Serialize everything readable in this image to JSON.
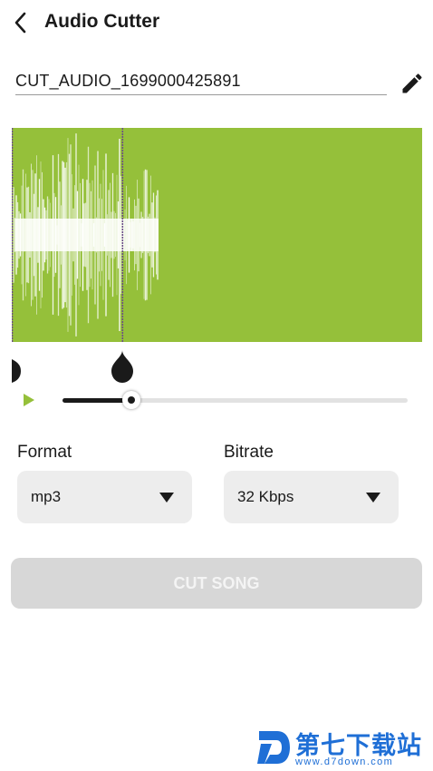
{
  "header": {
    "title": "Audio Cutter",
    "back_icon": "chevron-left-icon"
  },
  "file": {
    "name": "CUT_AUDIO_1699000425891",
    "edit_icon": "pencil-icon"
  },
  "waveform": {
    "background": "#95c03a",
    "wave_color": "#ffffff",
    "selection_start": 0.0,
    "selection_end": 0.27
  },
  "player": {
    "play_icon": "play-icon",
    "progress": 0.2,
    "accent": "#95c03a"
  },
  "format": {
    "label": "Format",
    "value": "mp3"
  },
  "bitrate": {
    "label": "Bitrate",
    "value": "32 Kbps"
  },
  "cut_button": {
    "label": "CUT SONG"
  },
  "watermark": {
    "cn": "第七下载站",
    "url": "www.d7down.com"
  }
}
